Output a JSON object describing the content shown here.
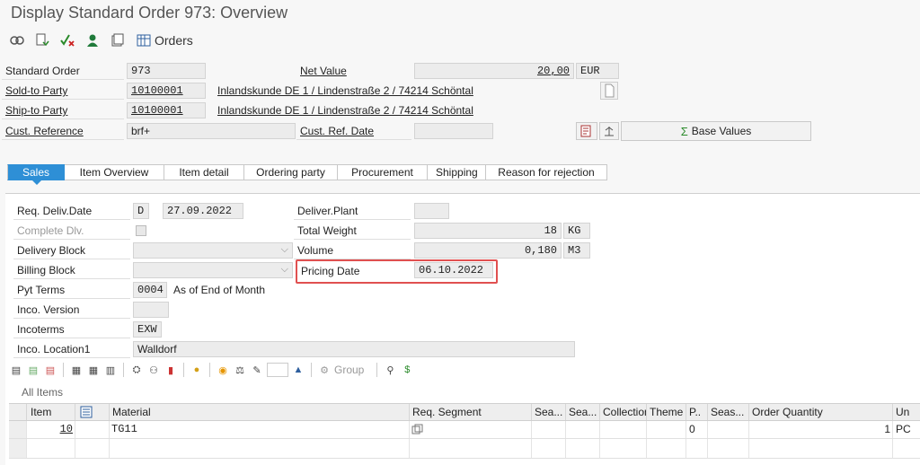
{
  "window": {
    "title": "Display Standard Order 973: Overview"
  },
  "toolbar": {
    "icons": [
      "display-document-flow-icon",
      "display-status-icon",
      "check-cancel-icon",
      "business-partner-icon",
      "print-preview-icon"
    ],
    "orders_label": "Orders"
  },
  "header": {
    "standard_order_label": "Standard Order",
    "standard_order_value": "973",
    "net_value_label": "Net Value",
    "net_value": "20,00",
    "currency": "EUR",
    "sold_to_label": "Sold-to Party",
    "sold_to_value": "10100001",
    "sold_to_text": "Inlandskunde DE 1 / Lindenstraße 2 / 74214 Schöntal",
    "ship_to_label": "Ship-to Party",
    "ship_to_value": "10100001",
    "ship_to_text": "Inlandskunde DE 1 / Lindenstraße 2 / 74214 Schöntal",
    "cust_ref_label": "Cust. Reference",
    "cust_ref_value": "brf+",
    "cust_ref_date_label": "Cust. Ref. Date",
    "cust_ref_date_value": "",
    "base_values_label": "Base Values"
  },
  "tabs": [
    {
      "label": "Sales",
      "active": true
    },
    {
      "label": "Item Overview",
      "active": false
    },
    {
      "label": "Item detail",
      "active": false
    },
    {
      "label": "Ordering party",
      "active": false
    },
    {
      "label": "Procurement",
      "active": false
    },
    {
      "label": "Shipping",
      "active": false
    },
    {
      "label": "Reason for rejection",
      "active": false
    }
  ],
  "sales": {
    "req_deliv_date_label": "Req. Deliv.Date",
    "req_deliv_date_type": "D",
    "req_deliv_date": "27.09.2022",
    "deliver_plant_label": "Deliver.Plant",
    "deliver_plant_value": "",
    "complete_dlv_label": "Complete Dlv.",
    "total_weight_label": "Total Weight",
    "total_weight": "18",
    "weight_unit": "KG",
    "delivery_block_label": "Delivery Block",
    "delivery_block_value": "",
    "volume_label": "Volume",
    "volume": "0,180",
    "volume_unit": "M3",
    "billing_block_label": "Billing Block",
    "billing_block_value": "",
    "pricing_date_label": "Pricing Date",
    "pricing_date": "06.10.2022",
    "pyt_terms_label": "Pyt Terms",
    "pyt_terms_code": "0004",
    "pyt_terms_text": "As of End of Month",
    "inco_version_label": "Inco. Version",
    "inco_version_value": "",
    "incoterms_label": "Incoterms",
    "incoterms_value": "EXW",
    "inco_location_label": "Inco. Location1",
    "inco_location_value": "Walldorf"
  },
  "grid_toolbar": {
    "group_label": "Group"
  },
  "items": {
    "title": "All Items",
    "columns": [
      "Item",
      "",
      "Material",
      "Req. Segment",
      "Sea...",
      "Sea...",
      "Collection",
      "Theme",
      "P..",
      "Seas...",
      "Order Quantity",
      "Un"
    ],
    "rows": [
      {
        "item": "10",
        "material": "TG11",
        "p": "0",
        "qty": "1",
        "unit": "PC"
      }
    ]
  }
}
